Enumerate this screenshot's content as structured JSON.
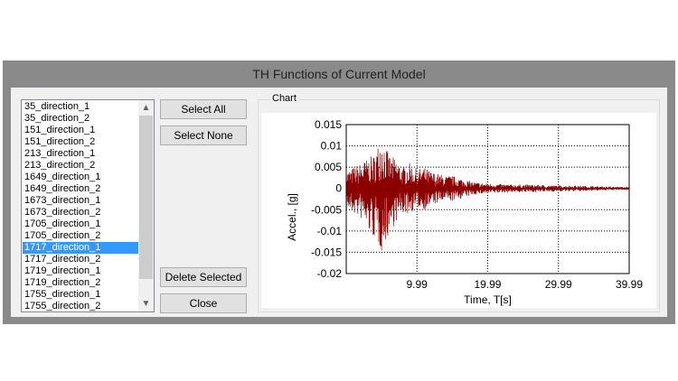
{
  "window": {
    "title": "TH Functions of Current Model"
  },
  "list": {
    "items": [
      "35_direction_1",
      "35_direction_2",
      "151_direction_1",
      "151_direction_2",
      "213_direction_1",
      "213_direction_2",
      "1649_direction_1",
      "1649_direction_2",
      "1673_direction_1",
      "1673_direction_2",
      "1705_direction_1",
      "1705_direction_2",
      "1717_direction_1",
      "1717_direction_2",
      "1719_direction_1",
      "1719_direction_2",
      "1755_direction_1",
      "1755_direction_2"
    ],
    "selected_index": 12
  },
  "buttons": {
    "select_all": "Select All",
    "select_none": "Select None",
    "delete_selected": "Delete Selected",
    "close": "Close"
  },
  "chart_group_label": "Chart",
  "colors": {
    "series": "#8b0000",
    "selection": "#3399ff"
  },
  "chart_data": {
    "type": "line",
    "title": "",
    "xlabel": "Time, T[s]",
    "ylabel": "Accel., [g]",
    "xlim": [
      0,
      39.99
    ],
    "ylim": [
      -0.02,
      0.015
    ],
    "x_ticks": [
      "9.99",
      "19.99",
      "29.99",
      "39.99"
    ],
    "y_ticks": [
      "0.015",
      "0.01",
      "0.005",
      "0",
      "-0.005",
      "-0.01",
      "-0.015",
      "-0.02"
    ],
    "grid": true,
    "series": [
      {
        "x": [
          0,
          1,
          2,
          3,
          4,
          5,
          6,
          7,
          8,
          9,
          10,
          11,
          12,
          13,
          14,
          15,
          16,
          17,
          18,
          19,
          20,
          22,
          24,
          26,
          28,
          30,
          32,
          34,
          36,
          38,
          39.99
        ],
        "y_max": [
          0.004,
          0.005,
          0.006,
          0.007,
          0.008,
          0.013,
          0.008,
          0.007,
          0.005,
          0.006,
          0.0045,
          0.005,
          0.004,
          0.0035,
          0.003,
          0.003,
          0.0025,
          0.002,
          0.0015,
          0.0013,
          0.0012,
          0.001,
          0.0009,
          0.0009,
          0.0008,
          0.0007,
          0.0007,
          0.0006,
          0.0005,
          0.0004,
          0.0003
        ],
        "y_min": [
          -0.005,
          -0.006,
          -0.007,
          -0.01,
          -0.012,
          -0.015,
          -0.011,
          -0.008,
          -0.006,
          -0.006,
          -0.0045,
          -0.005,
          -0.004,
          -0.0035,
          -0.003,
          -0.003,
          -0.0025,
          -0.002,
          -0.0015,
          -0.0013,
          -0.0012,
          -0.001,
          -0.0009,
          -0.0009,
          -0.0008,
          -0.0007,
          -0.0007,
          -0.0006,
          -0.0005,
          -0.0004,
          -0.0003
        ]
      }
    ]
  }
}
